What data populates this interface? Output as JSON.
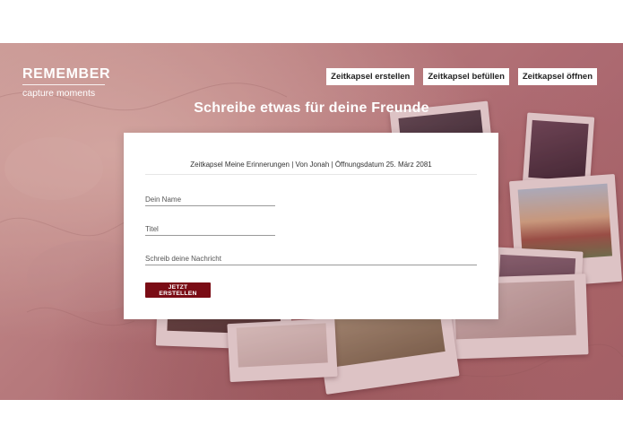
{
  "brand": {
    "title": "REMEMBER",
    "tagline": "capture moments"
  },
  "nav": {
    "items": [
      {
        "label": "Zeitkapsel erstellen"
      },
      {
        "label": "Zeitkapsel befüllen"
      },
      {
        "label": "Zeitkapsel öffnen"
      }
    ]
  },
  "headline": "Schreibe etwas für deine Freunde",
  "form": {
    "info": "Zeitkapsel Meine Erinnerungen | Von Jonah | Öffnungsdatum 25. März 2081",
    "name_placeholder": "Dein Name",
    "title_placeholder": "Titel",
    "message_placeholder": "Schreib deine Nachricht",
    "submit_label": "JETZT ERSTELLEN"
  },
  "colors": {
    "accent": "#7a0c15",
    "hero_tint": "#c58d8e"
  }
}
